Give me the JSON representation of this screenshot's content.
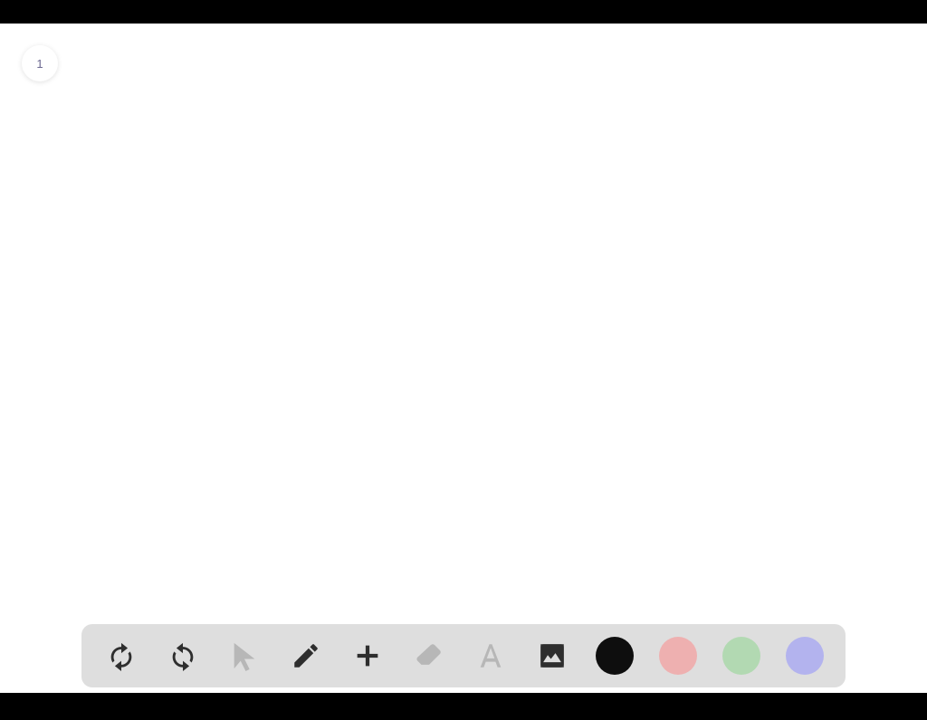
{
  "page_number": "1",
  "toolbar": {
    "tools": [
      {
        "id": "undo",
        "active": true
      },
      {
        "id": "redo",
        "active": true
      },
      {
        "id": "cursor",
        "active": false
      },
      {
        "id": "pencil",
        "active": true
      },
      {
        "id": "add",
        "active": true
      },
      {
        "id": "eraser",
        "active": false
      },
      {
        "id": "text",
        "active": false
      },
      {
        "id": "image",
        "active": true
      }
    ],
    "colors": {
      "black": "#0e0e0e",
      "red": "#eeb0b0",
      "green": "#b2d9b2",
      "purple": "#b3b3ee"
    }
  }
}
